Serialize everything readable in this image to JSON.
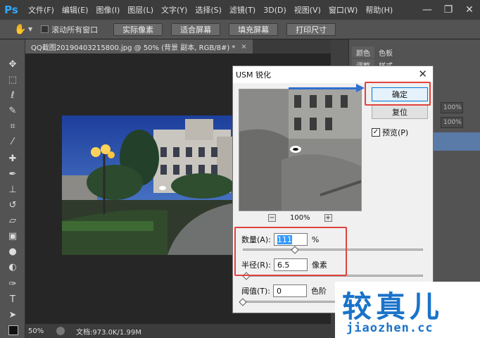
{
  "app": {
    "logo": "Ps",
    "accent": "#31a8ff"
  },
  "menu": [
    "文件(F)",
    "编辑(E)",
    "图像(I)",
    "图层(L)",
    "文字(Y)",
    "选择(S)",
    "滤镜(T)",
    "3D(D)",
    "视图(V)",
    "窗口(W)",
    "帮助(H)"
  ],
  "window_controls": {
    "minimize": "—",
    "restore": "❐",
    "close": "✕"
  },
  "options_bar": {
    "tool_icon": "hand-icon",
    "scroll_all_label": "滚动所有窗口",
    "buttons": [
      "实际像素",
      "适合屏幕",
      "填充屏幕",
      "打印尺寸"
    ]
  },
  "document": {
    "tab_title": "QQ截图20190403215800.jpg @ 50% (背景 副本, RGB/8#) *",
    "close": "×"
  },
  "status": {
    "zoom": "50%",
    "doc_info": "文档:973.0K/1.99M"
  },
  "panels": {
    "tabs_top": [
      "颜色",
      "色板"
    ],
    "tabs_second": [
      "调整",
      "样式"
    ],
    "opacity": "100%",
    "fill": "100%"
  },
  "dialog": {
    "title": "USM 锐化",
    "close": "✕",
    "ok_label": "确定",
    "reset_label": "复位",
    "preview_label": "预览(P)",
    "preview_checked": "✓",
    "zoom_minus": "−",
    "zoom_plus": "+",
    "zoom_level": "100%",
    "amount": {
      "label": "数量(A):",
      "value": "111",
      "unit": "%",
      "slider_fraction": 0.29
    },
    "radius": {
      "label": "半径(R):",
      "value": "6.5",
      "unit": "像素",
      "slider_fraction": 0.02
    },
    "threshold": {
      "label": "阈值(T):",
      "value": "0",
      "unit": "色阶",
      "slider_fraction": 0.0
    }
  },
  "watermark": {
    "main": "较真儿",
    "sub": "jiaozhen.cc",
    "color": "#1a73c9"
  },
  "highlight_color": "#e0433f"
}
